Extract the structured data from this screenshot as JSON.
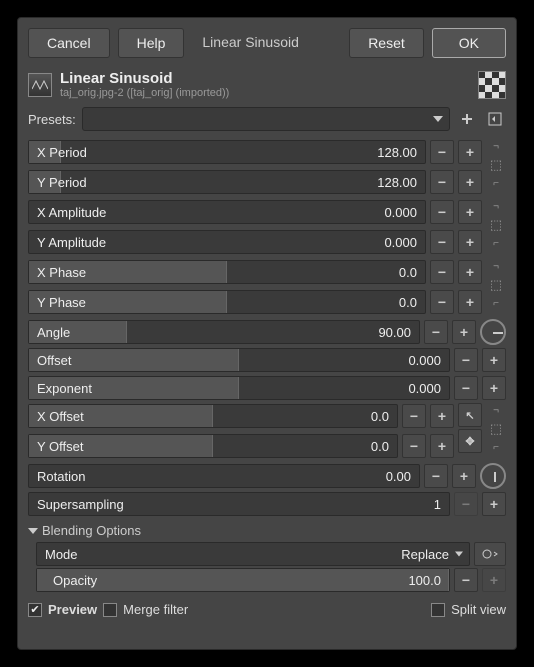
{
  "buttons": {
    "cancel": "Cancel",
    "help": "Help",
    "reset": "Reset",
    "ok": "OK"
  },
  "title": "Linear Sinusoid",
  "headlabel": "Linear Sinusoid",
  "subtitle": "taj_orig.jpg-2 ([taj_orig] (imported))",
  "presets_label": "Presets:",
  "params": {
    "xperiod": {
      "label": "X Period",
      "value": "128.00",
      "fill": 8
    },
    "yperiod": {
      "label": "Y Period",
      "value": "128.00",
      "fill": 8
    },
    "xamp": {
      "label": "X Amplitude",
      "value": "0.000",
      "fill": 0
    },
    "yamp": {
      "label": "Y Amplitude",
      "value": "0.000",
      "fill": 0
    },
    "xphase": {
      "label": "X Phase",
      "value": "0.0",
      "fill": 50
    },
    "yphase": {
      "label": "Y Phase",
      "value": "0.0",
      "fill": 50
    },
    "angle": {
      "label": "Angle",
      "value": "90.00",
      "fill": 25
    },
    "offset": {
      "label": "Offset",
      "value": "0.000",
      "fill": 50
    },
    "exponent": {
      "label": "Exponent",
      "value": "0.000",
      "fill": 50
    },
    "xoffset": {
      "label": "X Offset",
      "value": "0.0",
      "fill": 50
    },
    "yoffset": {
      "label": "Y Offset",
      "value": "0.0",
      "fill": 50
    },
    "rotation": {
      "label": "Rotation",
      "value": "0.00",
      "fill": 0
    },
    "supersampling": {
      "label": "Supersampling",
      "value": "1",
      "fill": 0
    }
  },
  "blending": {
    "header": "Blending Options",
    "mode_label": "Mode",
    "mode_value": "Replace",
    "opacity_label": "Opacity",
    "opacity_value": "100.0"
  },
  "footer": {
    "preview": "Preview",
    "merge": "Merge filter",
    "split": "Split view"
  }
}
